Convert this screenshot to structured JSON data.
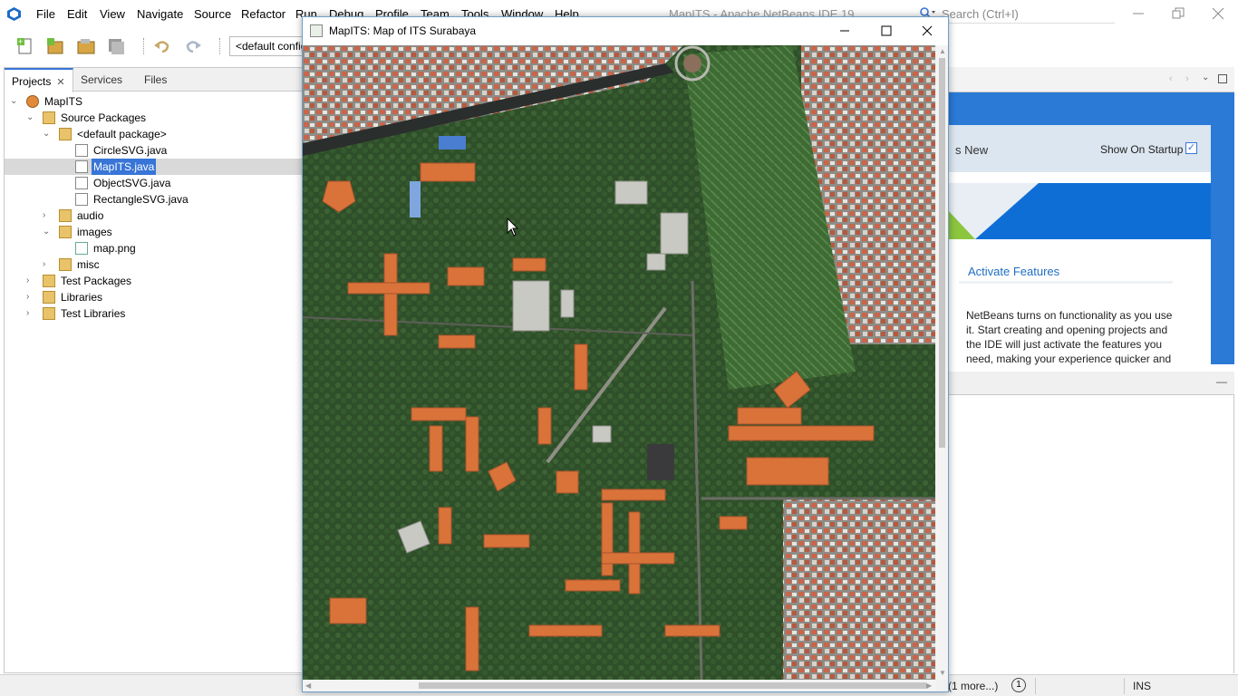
{
  "ide": {
    "title": "MapITS - Apache NetBeans IDE 19",
    "menu": [
      "File",
      "Edit",
      "View",
      "Navigate",
      "Source",
      "Refactor",
      "Run",
      "Debug",
      "Profile",
      "Team",
      "Tools",
      "Window",
      "Help"
    ],
    "search_placeholder": "Search (Ctrl+I)",
    "config_combo": "<default config>"
  },
  "projects": {
    "tabs": [
      "Projects",
      "Services",
      "Files"
    ],
    "tree": [
      {
        "label": "MapITS",
        "icon": "project-icon"
      },
      {
        "label": "Source Packages",
        "icon": "source-packages-icon"
      },
      {
        "label": "<default package>",
        "icon": "package-icon"
      },
      {
        "label": "CircleSVG.java",
        "icon": "java-file-icon"
      },
      {
        "label": "MapITS.java",
        "icon": "java-main-file-icon",
        "selected": true
      },
      {
        "label": "ObjectSVG.java",
        "icon": "java-file-icon"
      },
      {
        "label": "RectangleSVG.java",
        "icon": "java-file-icon"
      },
      {
        "label": "audio",
        "icon": "package-icon"
      },
      {
        "label": "images",
        "icon": "package-icon"
      },
      {
        "label": "map.png",
        "icon": "image-file-icon"
      },
      {
        "label": "misc",
        "icon": "package-icon"
      },
      {
        "label": "Test Packages",
        "icon": "test-packages-icon"
      },
      {
        "label": "Libraries",
        "icon": "libraries-icon"
      },
      {
        "label": "Test Libraries",
        "icon": "libraries-icon"
      }
    ]
  },
  "start_page": {
    "whats_new": "s New",
    "show_on_startup": "Show On Startup",
    "show_on_startup_checked": true,
    "activate_title": "Activate Features",
    "activate_text": "NetBeans turns on functionality as you use it. Start creating and opening projects and the IDE will just activate the features you need, making your experience quicker and"
  },
  "statusbar": {
    "more": "(1 more...)",
    "notifications": "1",
    "insert_mode": "INS"
  },
  "map_window": {
    "title": "MapITS: Map of ITS Surabaya"
  },
  "colors": {
    "accent": "#3875d7",
    "roof_orange": "#d9733a",
    "vegetation": "#3f6b35"
  }
}
